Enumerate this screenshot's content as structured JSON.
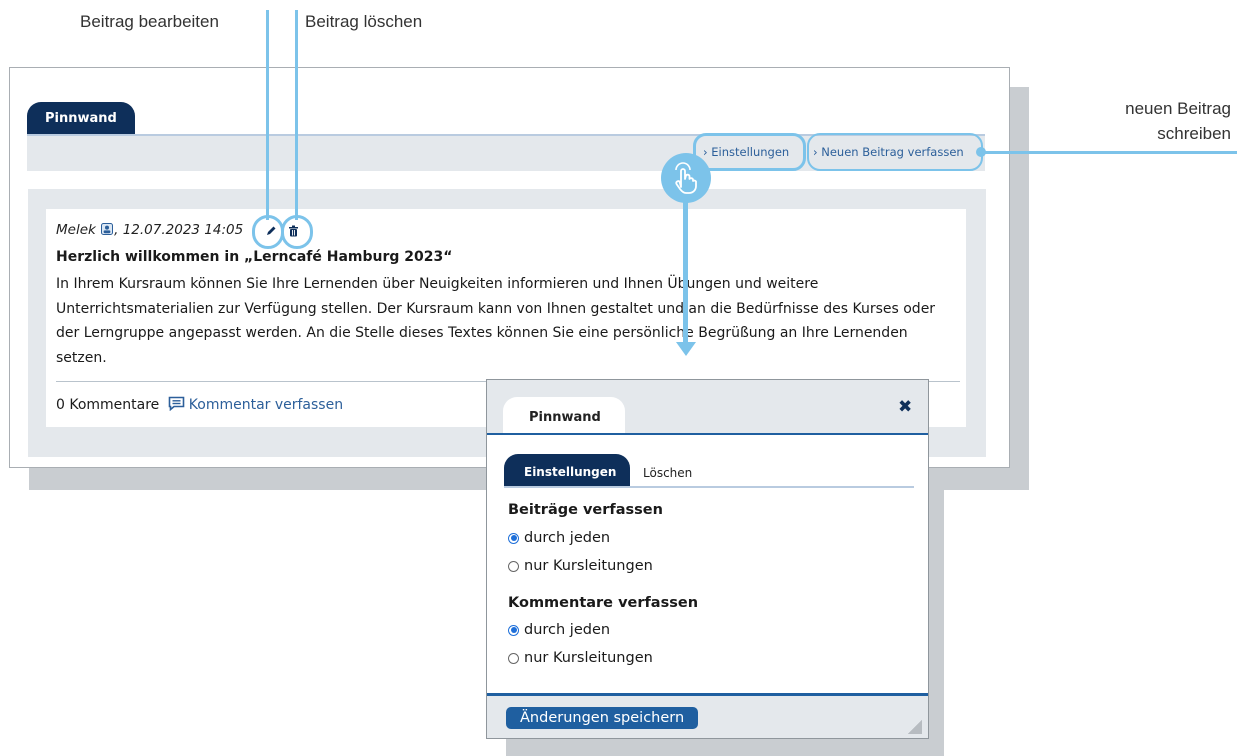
{
  "callouts": {
    "edit": "Beitrag bearbeiten",
    "delete": "Beitrag löschen",
    "new_line1": "neuen Beitrag",
    "new_line2": "schreiben"
  },
  "board": {
    "tab_label": "Pinnwand",
    "settings_link": "› Einstellungen",
    "new_post_link": "› Neuen Beitrag verfassen"
  },
  "post": {
    "author": "Melek",
    "date": ", 12.07.2023 14:05",
    "title": "Herzlich willkommen in „Lerncafé Hamburg 2023“",
    "body": "In Ihrem Kursraum können Sie Ihre Lernenden über Neuigkeiten informieren und Ihnen Übungen und weitere Unterrichtsmaterialien zur Verfügung stellen. Der Kursraum kann von Ihnen gestaltet und an die Bedürfnisse des Kurses oder der Lerngruppe angepasst werden. An die Stelle dieses Textes können Sie eine persönliche Begrüßung an Ihre Lernenden setzen.",
    "comments_count": "0 Kommentare",
    "comment_link": "Kommentar verfassen"
  },
  "dialog": {
    "tab_label": "Pinnwand",
    "close": "✖",
    "subtabs": {
      "settings": "Einstellungen",
      "delete": "Löschen"
    },
    "section1": "Beiträge verfassen",
    "section1_options": [
      "durch jeden",
      "nur Kursleitungen"
    ],
    "section1_selected": 0,
    "section2": "Kommentare verfassen",
    "section2_options": [
      "durch jeden",
      "nur Kursleitungen"
    ],
    "section2_selected": 0,
    "save_button": "Änderungen speichern"
  },
  "colors": {
    "accent": "#0e2f5a",
    "link": "#2c5f9a",
    "highlight": "#7cc3ea",
    "button": "#1f5fa0"
  }
}
